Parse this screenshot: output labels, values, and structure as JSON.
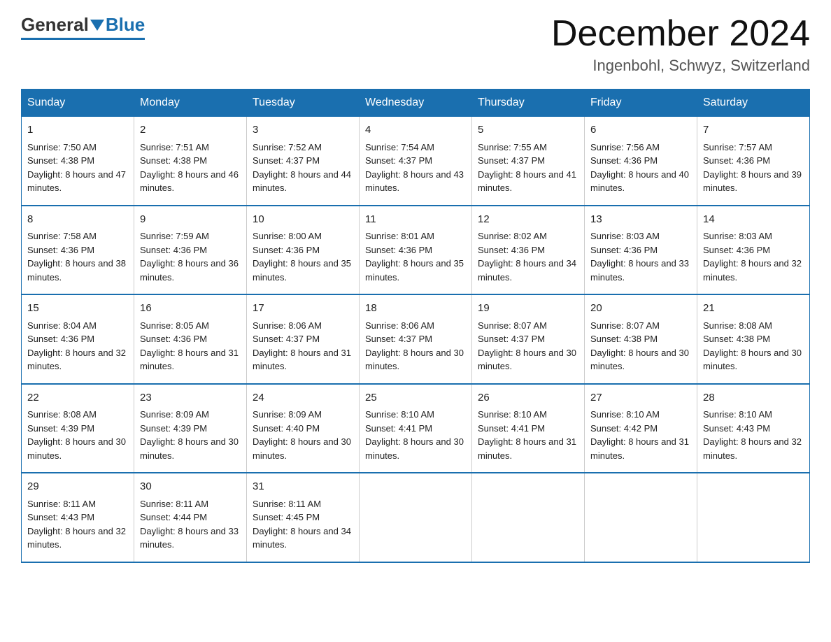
{
  "header": {
    "logo_general": "General",
    "logo_blue": "Blue",
    "month_title": "December 2024",
    "location": "Ingenbohl, Schwyz, Switzerland"
  },
  "days_of_week": [
    "Sunday",
    "Monday",
    "Tuesday",
    "Wednesday",
    "Thursday",
    "Friday",
    "Saturday"
  ],
  "weeks": [
    [
      {
        "day": "1",
        "sunrise": "Sunrise: 7:50 AM",
        "sunset": "Sunset: 4:38 PM",
        "daylight": "Daylight: 8 hours and 47 minutes."
      },
      {
        "day": "2",
        "sunrise": "Sunrise: 7:51 AM",
        "sunset": "Sunset: 4:38 PM",
        "daylight": "Daylight: 8 hours and 46 minutes."
      },
      {
        "day": "3",
        "sunrise": "Sunrise: 7:52 AM",
        "sunset": "Sunset: 4:37 PM",
        "daylight": "Daylight: 8 hours and 44 minutes."
      },
      {
        "day": "4",
        "sunrise": "Sunrise: 7:54 AM",
        "sunset": "Sunset: 4:37 PM",
        "daylight": "Daylight: 8 hours and 43 minutes."
      },
      {
        "day": "5",
        "sunrise": "Sunrise: 7:55 AM",
        "sunset": "Sunset: 4:37 PM",
        "daylight": "Daylight: 8 hours and 41 minutes."
      },
      {
        "day": "6",
        "sunrise": "Sunrise: 7:56 AM",
        "sunset": "Sunset: 4:36 PM",
        "daylight": "Daylight: 8 hours and 40 minutes."
      },
      {
        "day": "7",
        "sunrise": "Sunrise: 7:57 AM",
        "sunset": "Sunset: 4:36 PM",
        "daylight": "Daylight: 8 hours and 39 minutes."
      }
    ],
    [
      {
        "day": "8",
        "sunrise": "Sunrise: 7:58 AM",
        "sunset": "Sunset: 4:36 PM",
        "daylight": "Daylight: 8 hours and 38 minutes."
      },
      {
        "day": "9",
        "sunrise": "Sunrise: 7:59 AM",
        "sunset": "Sunset: 4:36 PM",
        "daylight": "Daylight: 8 hours and 36 minutes."
      },
      {
        "day": "10",
        "sunrise": "Sunrise: 8:00 AM",
        "sunset": "Sunset: 4:36 PM",
        "daylight": "Daylight: 8 hours and 35 minutes."
      },
      {
        "day": "11",
        "sunrise": "Sunrise: 8:01 AM",
        "sunset": "Sunset: 4:36 PM",
        "daylight": "Daylight: 8 hours and 35 minutes."
      },
      {
        "day": "12",
        "sunrise": "Sunrise: 8:02 AM",
        "sunset": "Sunset: 4:36 PM",
        "daylight": "Daylight: 8 hours and 34 minutes."
      },
      {
        "day": "13",
        "sunrise": "Sunrise: 8:03 AM",
        "sunset": "Sunset: 4:36 PM",
        "daylight": "Daylight: 8 hours and 33 minutes."
      },
      {
        "day": "14",
        "sunrise": "Sunrise: 8:03 AM",
        "sunset": "Sunset: 4:36 PM",
        "daylight": "Daylight: 8 hours and 32 minutes."
      }
    ],
    [
      {
        "day": "15",
        "sunrise": "Sunrise: 8:04 AM",
        "sunset": "Sunset: 4:36 PM",
        "daylight": "Daylight: 8 hours and 32 minutes."
      },
      {
        "day": "16",
        "sunrise": "Sunrise: 8:05 AM",
        "sunset": "Sunset: 4:36 PM",
        "daylight": "Daylight: 8 hours and 31 minutes."
      },
      {
        "day": "17",
        "sunrise": "Sunrise: 8:06 AM",
        "sunset": "Sunset: 4:37 PM",
        "daylight": "Daylight: 8 hours and 31 minutes."
      },
      {
        "day": "18",
        "sunrise": "Sunrise: 8:06 AM",
        "sunset": "Sunset: 4:37 PM",
        "daylight": "Daylight: 8 hours and 30 minutes."
      },
      {
        "day": "19",
        "sunrise": "Sunrise: 8:07 AM",
        "sunset": "Sunset: 4:37 PM",
        "daylight": "Daylight: 8 hours and 30 minutes."
      },
      {
        "day": "20",
        "sunrise": "Sunrise: 8:07 AM",
        "sunset": "Sunset: 4:38 PM",
        "daylight": "Daylight: 8 hours and 30 minutes."
      },
      {
        "day": "21",
        "sunrise": "Sunrise: 8:08 AM",
        "sunset": "Sunset: 4:38 PM",
        "daylight": "Daylight: 8 hours and 30 minutes."
      }
    ],
    [
      {
        "day": "22",
        "sunrise": "Sunrise: 8:08 AM",
        "sunset": "Sunset: 4:39 PM",
        "daylight": "Daylight: 8 hours and 30 minutes."
      },
      {
        "day": "23",
        "sunrise": "Sunrise: 8:09 AM",
        "sunset": "Sunset: 4:39 PM",
        "daylight": "Daylight: 8 hours and 30 minutes."
      },
      {
        "day": "24",
        "sunrise": "Sunrise: 8:09 AM",
        "sunset": "Sunset: 4:40 PM",
        "daylight": "Daylight: 8 hours and 30 minutes."
      },
      {
        "day": "25",
        "sunrise": "Sunrise: 8:10 AM",
        "sunset": "Sunset: 4:41 PM",
        "daylight": "Daylight: 8 hours and 30 minutes."
      },
      {
        "day": "26",
        "sunrise": "Sunrise: 8:10 AM",
        "sunset": "Sunset: 4:41 PM",
        "daylight": "Daylight: 8 hours and 31 minutes."
      },
      {
        "day": "27",
        "sunrise": "Sunrise: 8:10 AM",
        "sunset": "Sunset: 4:42 PM",
        "daylight": "Daylight: 8 hours and 31 minutes."
      },
      {
        "day": "28",
        "sunrise": "Sunrise: 8:10 AM",
        "sunset": "Sunset: 4:43 PM",
        "daylight": "Daylight: 8 hours and 32 minutes."
      }
    ],
    [
      {
        "day": "29",
        "sunrise": "Sunrise: 8:11 AM",
        "sunset": "Sunset: 4:43 PM",
        "daylight": "Daylight: 8 hours and 32 minutes."
      },
      {
        "day": "30",
        "sunrise": "Sunrise: 8:11 AM",
        "sunset": "Sunset: 4:44 PM",
        "daylight": "Daylight: 8 hours and 33 minutes."
      },
      {
        "day": "31",
        "sunrise": "Sunrise: 8:11 AM",
        "sunset": "Sunset: 4:45 PM",
        "daylight": "Daylight: 8 hours and 34 minutes."
      },
      {
        "day": "",
        "sunrise": "",
        "sunset": "",
        "daylight": ""
      },
      {
        "day": "",
        "sunrise": "",
        "sunset": "",
        "daylight": ""
      },
      {
        "day": "",
        "sunrise": "",
        "sunset": "",
        "daylight": ""
      },
      {
        "day": "",
        "sunrise": "",
        "sunset": "",
        "daylight": ""
      }
    ]
  ]
}
